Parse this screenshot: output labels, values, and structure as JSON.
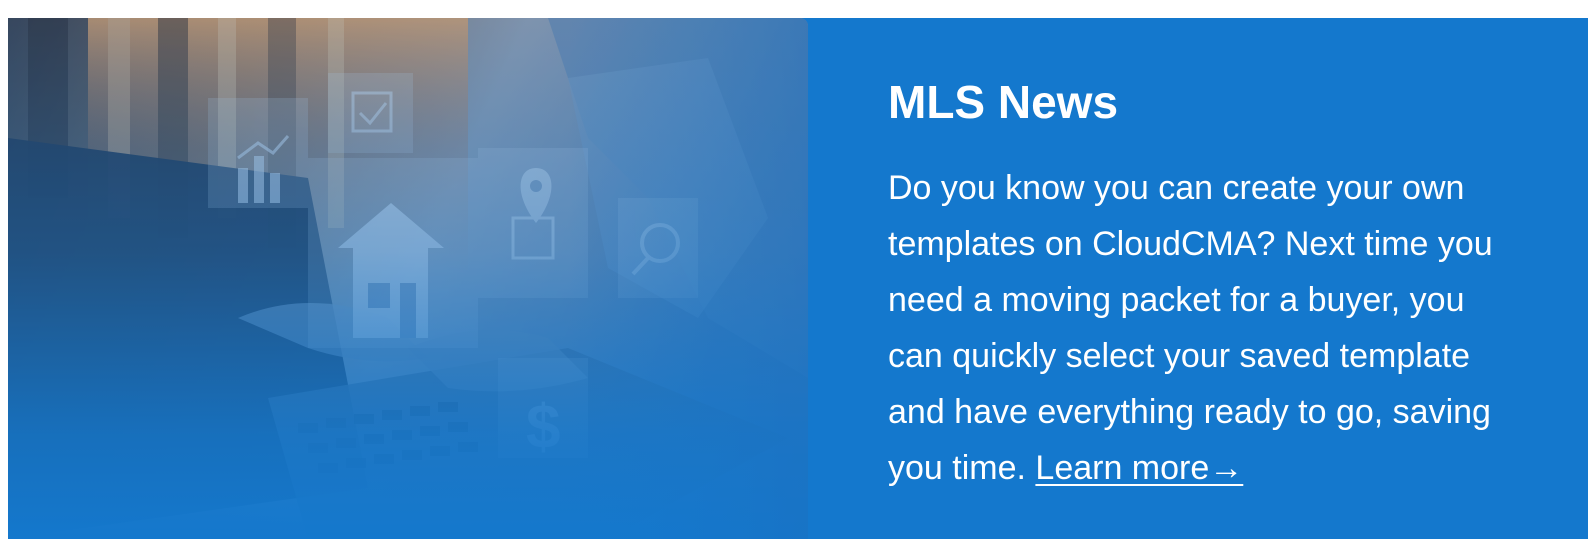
{
  "news": {
    "title": "MLS News",
    "body": "Do you know you can create your own templates on CloudCMA? Next time you need a moving packet for a buyer, you can quickly select your saved template and have everything ready to go, saving you time.",
    "link_label": "Learn more→"
  },
  "hero": {
    "icons": [
      "bar-chart-icon",
      "checkbox-icon",
      "house-icon",
      "location-pin-icon",
      "magnifier-icon",
      "dollar-icon",
      "laptop-icon"
    ]
  },
  "colors": {
    "banner_blue": "#1478cd",
    "text": "#ffffff"
  }
}
